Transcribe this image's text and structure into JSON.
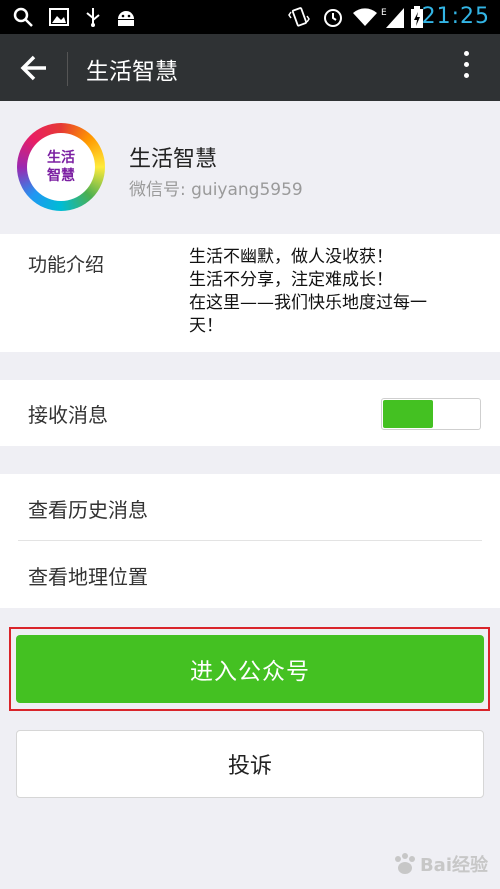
{
  "status_bar": {
    "time": "21:25",
    "icons": [
      "search-icon",
      "image-icon",
      "usb-icon",
      "android-icon",
      "vibrate-icon",
      "alarm-icon",
      "wifi-icon",
      "signal-icon",
      "battery-charging-icon"
    ],
    "time_color": "#33b5e5"
  },
  "action_bar": {
    "title": "生活智慧",
    "background": "#2f3234"
  },
  "profile": {
    "avatar_text_line1": "生活",
    "avatar_text_line2": "智慧",
    "name": "生活智慧",
    "wechat_id": "微信号: guiyang5959"
  },
  "intro": {
    "label": "功能介绍",
    "lines": [
      "生活不幽默，做人没收获！",
      "生活不分享，注定难成长！",
      "在这里——我们快乐地度过每一",
      "天！"
    ]
  },
  "receive": {
    "label": "接收消息",
    "toggle_on": true,
    "accent": "#44c122"
  },
  "links": {
    "history": "查看历史消息",
    "location": "查看地理位置"
  },
  "buttons": {
    "enter": "进入公众号",
    "complain": "投诉"
  },
  "watermark": {
    "text": "Bai经验"
  }
}
